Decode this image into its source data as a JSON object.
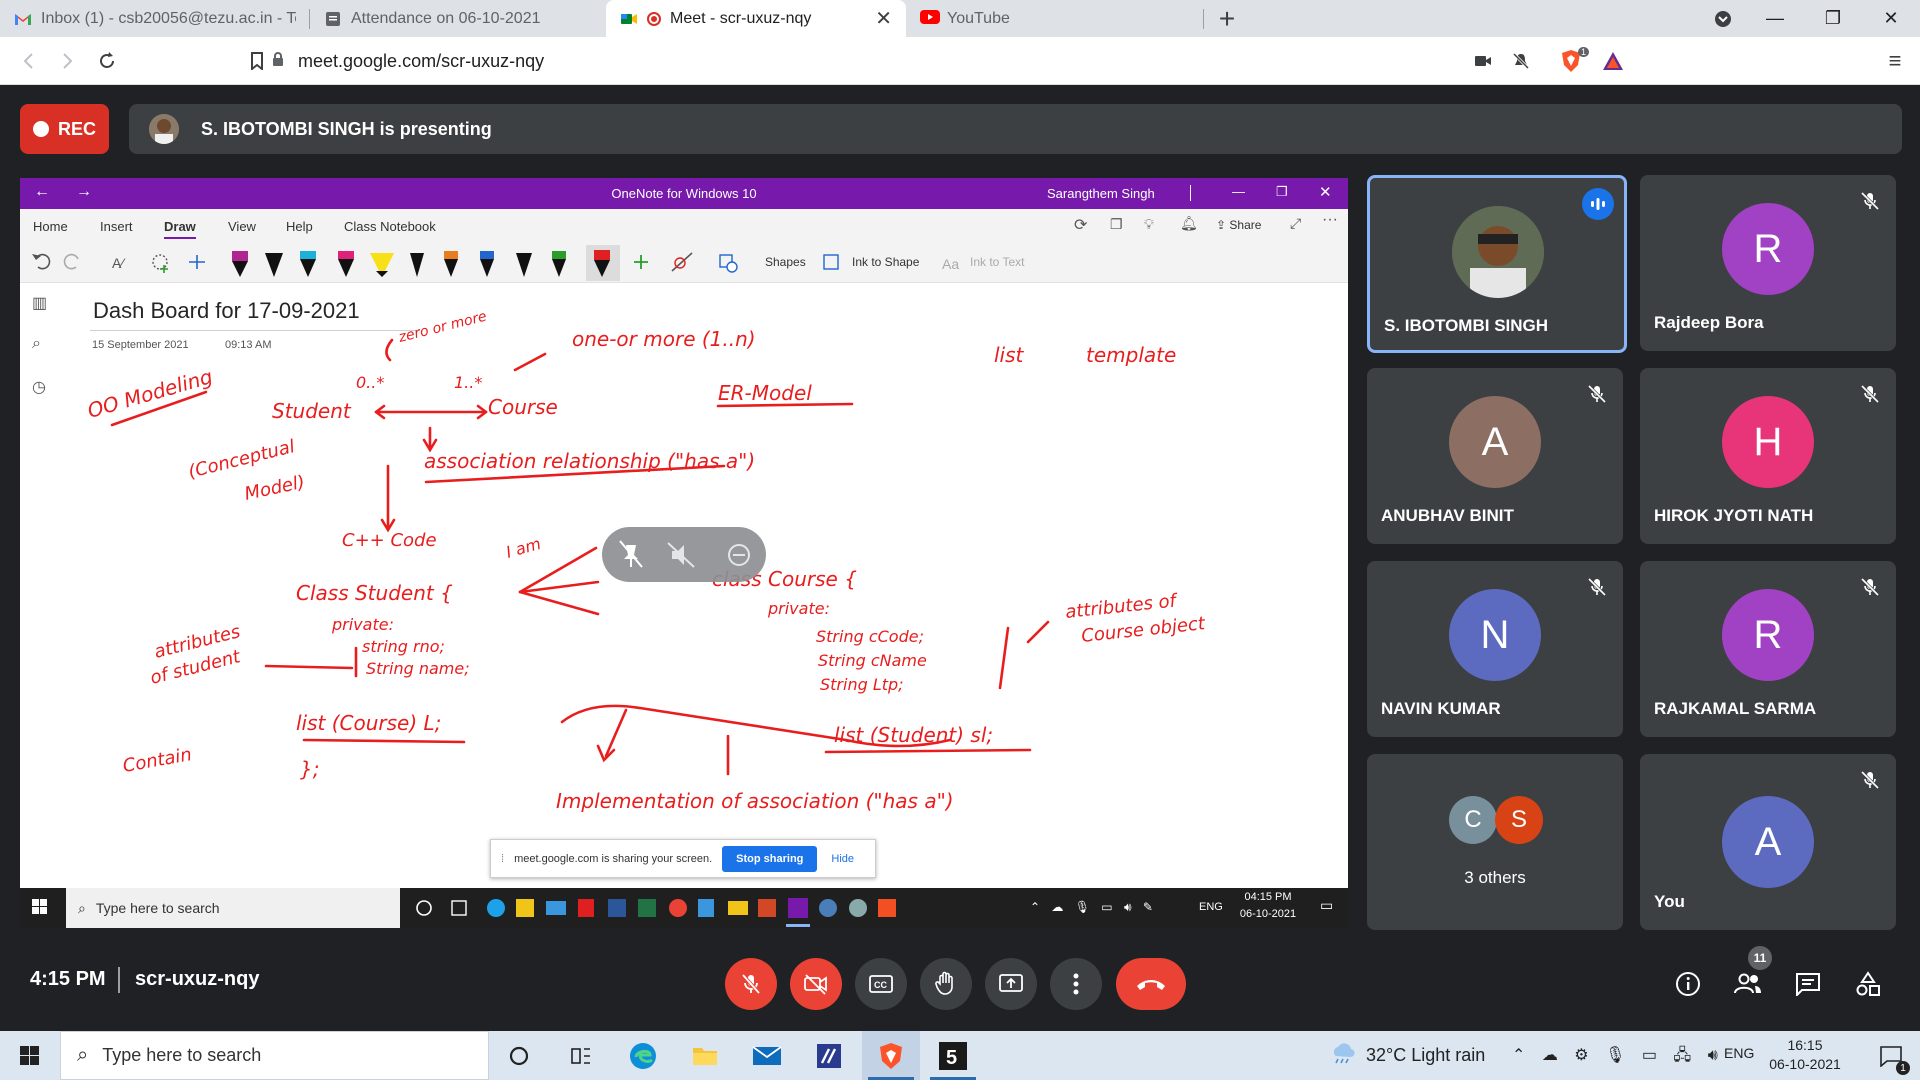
{
  "browser": {
    "tabs": [
      {
        "title": "Inbox (1) - csb20056@tezu.ac.in - Tez"
      },
      {
        "title": "Attendance on 06-10-2021"
      },
      {
        "title": "Meet - scr-uxuz-nqy"
      },
      {
        "title": "YouTube"
      }
    ],
    "url": "meet.google.com/scr-uxuz-nqy",
    "brave_badge": "1"
  },
  "meet": {
    "rec_label": "REC",
    "presenting_text": "S. IBOTOMBI SINGH is presenting",
    "time": "4:15 PM",
    "meeting_code": "scr-uxuz-nqy",
    "participant_count": "11",
    "tiles": [
      {
        "name": "S. IBOTOMBI SINGH",
        "initial": "",
        "color": "#6b5a4a"
      },
      {
        "name": "Rajdeep Bora",
        "initial": "R",
        "color": "#a142c4"
      },
      {
        "name": "ANUBHAV BINIT",
        "initial": "A",
        "color": "#8d6e63"
      },
      {
        "name": "HIROK JYOTI NATH",
        "initial": "H",
        "color": "#e8357a"
      },
      {
        "name": "NAVIN KUMAR",
        "initial": "N",
        "color": "#5c6bc0"
      },
      {
        "name": "RAJKAMAL SARMA",
        "initial": "R",
        "color": "#a142c4"
      },
      {
        "name": "3 others",
        "initial": "",
        "color": ""
      },
      {
        "name": "You",
        "initial": "A",
        "color": "#5c6bc0"
      }
    ],
    "others_avatars": [
      {
        "initial": "C",
        "color": "#78909c"
      },
      {
        "initial": "S",
        "color": "#d84315"
      }
    ]
  },
  "onenote": {
    "window_title": "OneNote for Windows 10",
    "user": "Sarangthem Singh",
    "ribbon_tabs": [
      "Home",
      "Insert",
      "Draw",
      "View",
      "Help",
      "Class Notebook"
    ],
    "share_label": "Share",
    "shapes_label": "Shapes",
    "ink_to_shape_label": "Ink to Shape",
    "ink_to_text_label": "Ink to Text",
    "page_title": "Dash  Board for  17-09-2021",
    "page_date": "15 September 2021",
    "page_time": "09:13 AM",
    "sharing_text": "meet.google.com is sharing your screen.",
    "stop_sharing": "Stop sharing",
    "hide": "Hide",
    "inner_search": "Type here to search",
    "inner_time": "04:15 PM",
    "inner_date": "06-10-2021",
    "inner_lang": "ENG"
  },
  "taskbar": {
    "search_placeholder": "Type here to search",
    "weather": "32°C  Light rain",
    "lang": "ENG",
    "time": "16:15",
    "date": "06-10-2021",
    "notification_count": "1"
  },
  "handwriting": {
    "oo_modeling": "OO Modeling",
    "zero_or_more": "zero or more",
    "one_or_more": "one-or more  (1..n)",
    "zero_star": "0..*",
    "one_star": "1..*",
    "student": "Student",
    "course": "Course",
    "er_model": "ER-Model",
    "list": "list",
    "template": "template",
    "conceptual": "(Conceptual",
    "model": "Model)",
    "association": "association relationship (\"has a\")",
    "cpp_code": "C++ Code",
    "class_student": "Class Student {",
    "private1": "private:",
    "string_rno": "string rno;",
    "string_name": "String name;",
    "attributes_student": "attributes",
    "of_student": "of student",
    "list_course": "list (Course) L;",
    "close_brace": "};",
    "contain": "Contain",
    "class_course": "class Course {",
    "private2": "private:",
    "string_ccode": "String cCode;",
    "string_cname": "String cName",
    "string_ltp": "String Ltp;",
    "attributes_course1": "attributes of",
    "attributes_course2": "Course object",
    "list_student": "list (Student) sl;",
    "implementation": "Implementation of association (\"has a\")",
    "i_am": "I am"
  }
}
